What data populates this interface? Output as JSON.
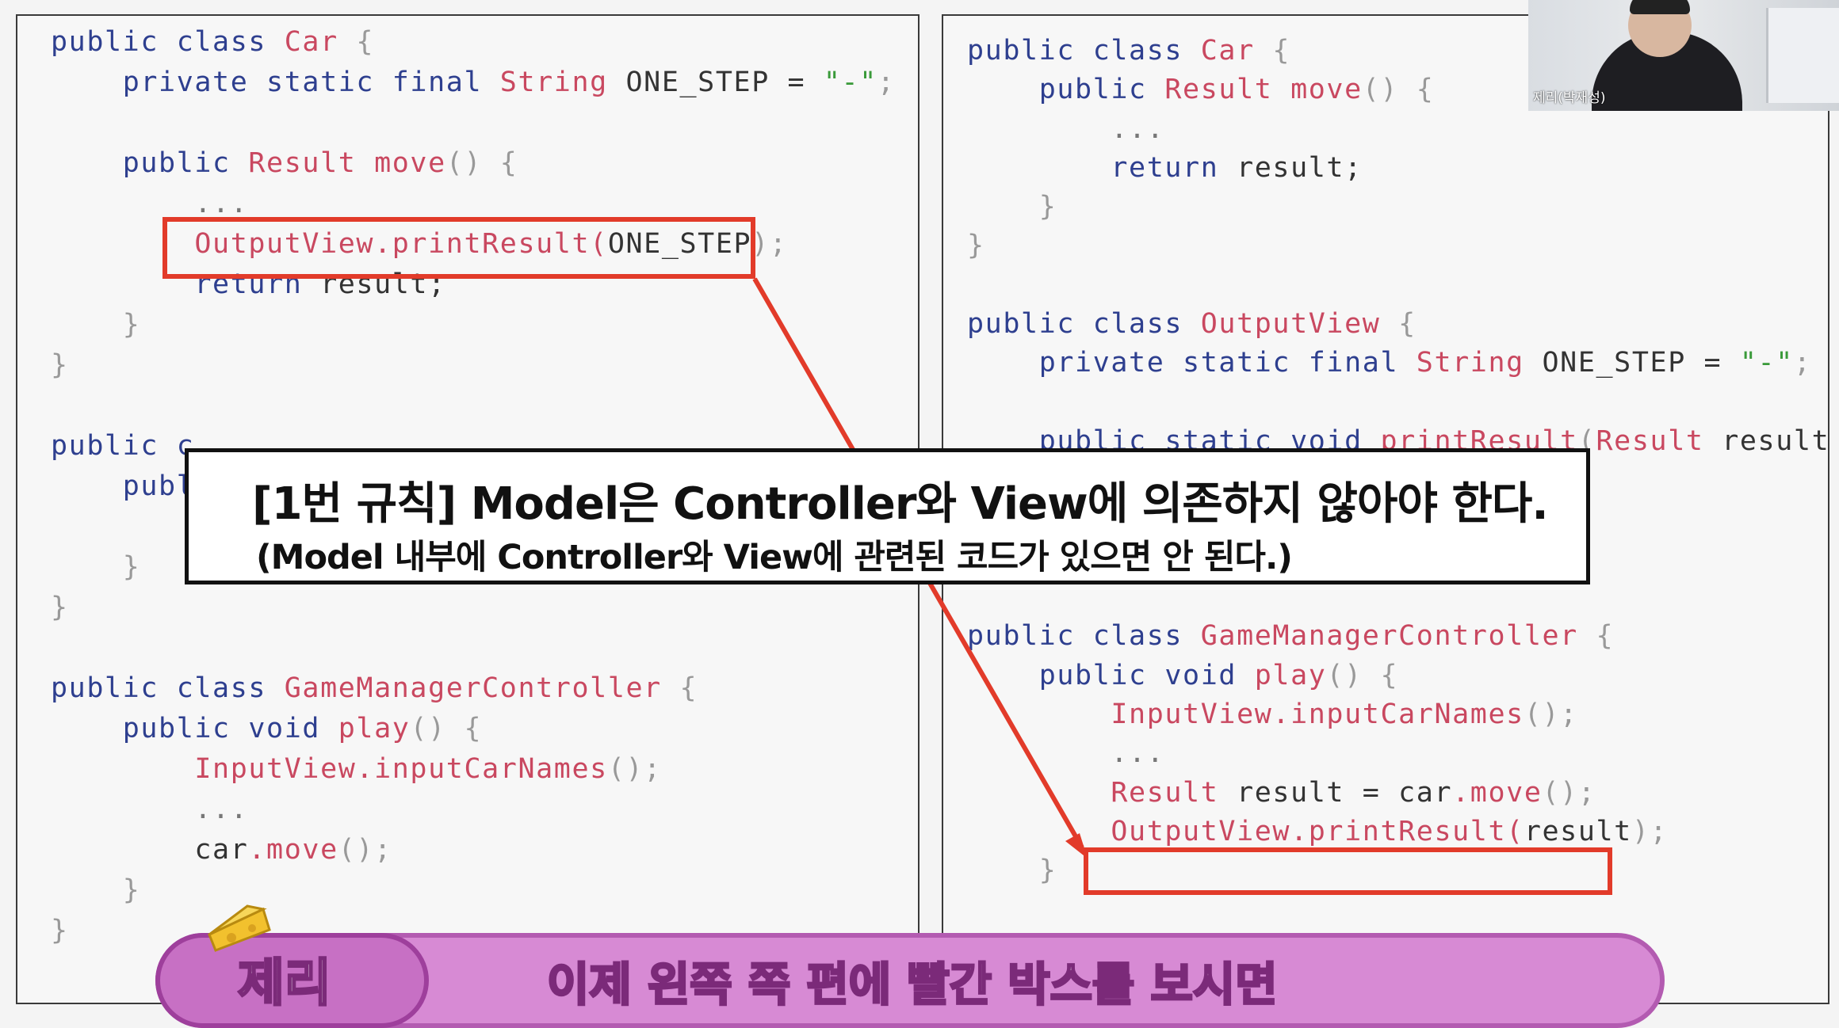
{
  "left_code": {
    "l1": {
      "kw": "public class",
      "name": "Car",
      "rest": " {"
    },
    "l2": {
      "kw": "private static final",
      "type": "String",
      "rest": " ONE_STEP = ",
      "str": "\"-\"",
      "end": ";"
    },
    "l3": {
      "kw": "public",
      "type": "Result",
      "name": "move",
      "rest": "() {"
    },
    "l4": "...",
    "l5": {
      "cls": "OutputView",
      "method": ".printResult(",
      "arg": "ONE_STEP",
      "end": ");"
    },
    "l6": {
      "kw": "return",
      "rest": " result;"
    },
    "l7": "}",
    "l8": "}",
    "l9": {
      "kw": "public",
      "rest": " c"
    },
    "l10": {
      "kw": "publ"
    },
    "l11": "}",
    "l12": "}",
    "l13": {
      "kw": "public class",
      "name": "GameManagerController",
      "rest": " {"
    },
    "l14": {
      "kw": "public void",
      "name": "play",
      "rest": "() {"
    },
    "l15": {
      "cls": "InputView",
      "method": ".inputCarNames",
      "end": "();"
    },
    "l16": "...",
    "l17": {
      "obj": "car",
      "method": ".move",
      "end": "();"
    },
    "l18": "}",
    "l19": "}"
  },
  "right_code": {
    "l1": {
      "kw": "public class",
      "name": "Car",
      "rest": " {"
    },
    "l2": {
      "kw": "public",
      "type": "Result",
      "name": "move",
      "rest": "() {"
    },
    "l3": "...",
    "l4": {
      "kw": "return",
      "rest": " result;"
    },
    "l5": "}",
    "l6": "}",
    "l7": {
      "kw": "public class",
      "name": "OutputView",
      "rest": " {"
    },
    "l8": {
      "kw": "private static final",
      "type": "String",
      "rest": " ONE_STEP = ",
      "str": "\"-\"",
      "end": ";"
    },
    "l9": {
      "kw": "public static void",
      "name": "printResult",
      "paren": "(",
      "type": "Result",
      "rest": " result) {"
    },
    "l10": "}",
    "l11": {
      "kw": "public class",
      "name": "GameManagerController",
      "rest": " {"
    },
    "l12": {
      "kw": "public void",
      "name": "play",
      "rest": "() {"
    },
    "l13": {
      "cls": "InputView",
      "method": ".inputCarNames",
      "end": "();"
    },
    "l14": "...",
    "l15": {
      "type": "Result",
      "rest": " result = car",
      "method": ".move",
      "end": "();"
    },
    "l16": {
      "cls": "OutputView",
      "method": ".printResult(",
      "arg": "result",
      "end": ");"
    },
    "l17": "}"
  },
  "rule": {
    "title": "[1번 규칙] Model은 Controller와 View에 의존하지 않아야 한다.",
    "subtitle": "(Model 내부에 Controller와 View에 관련된 코드가 있으면 안 된다.)"
  },
  "webcam": {
    "name": "제리(박재성)"
  },
  "caption": {
    "speaker": "제리",
    "text": "이제 왼쪽 쪽 편에 빨간 박스를 보시면"
  },
  "colors": {
    "highlight": "#e23b2a",
    "keyword": "#2e3f8f",
    "class": "#c94860",
    "string": "#3a9a3a",
    "caption_bg": "#d78ad4"
  }
}
